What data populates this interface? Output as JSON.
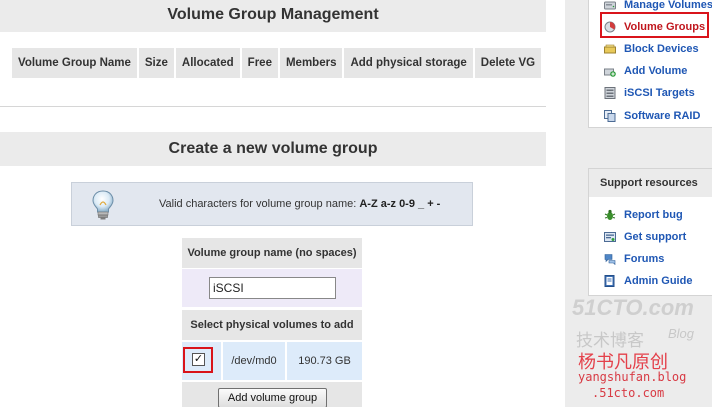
{
  "main": {
    "management_title": "Volume Group Management",
    "table_headers": [
      "Volume Group Name",
      "Size",
      "Allocated",
      "Free",
      "Members",
      "Add physical storage",
      "Delete VG"
    ],
    "create_title": "Create a new volume group",
    "info": {
      "prefix": "Valid characters for volume group name: ",
      "chars": "A-Z a-z 0-9 _ + -"
    },
    "form": {
      "name_label": "Volume group name (no spaces)",
      "name_value": "iSCSI",
      "pv_label": "Select physical volumes to add",
      "pv": {
        "checked": true,
        "check_mark": "✓",
        "device": "/dev/md0",
        "size": "190.73 GB"
      },
      "submit_label": "Add volume group"
    }
  },
  "sidebar": {
    "nav_items": [
      {
        "label": "Manage Volumes",
        "icon": "hard-disk-icon"
      },
      {
        "label": "Volume Groups",
        "icon": "volume-group-icon",
        "active": true
      },
      {
        "label": "Block Devices",
        "icon": "block-devices-icon"
      },
      {
        "label": "Add Volume",
        "icon": "add-volume-icon"
      },
      {
        "label": "iSCSI Targets",
        "icon": "iscsi-targets-icon"
      },
      {
        "label": "Software RAID",
        "icon": "software-raid-icon"
      }
    ],
    "support": {
      "title": "Support resources",
      "items": [
        {
          "label": "Report bug",
          "icon": "bug-icon"
        },
        {
          "label": "Get support",
          "icon": "support-icon"
        },
        {
          "label": "Forums",
          "icon": "forums-icon"
        },
        {
          "label": "Admin Guide",
          "icon": "admin-guide-icon"
        }
      ]
    }
  },
  "watermark": {
    "line1": "51CTO.com",
    "line2": "技术博客",
    "line2b": "Blog",
    "line3": "杨书凡原创",
    "line4": "yangshufan.blog",
    "line5": ".51cto.com"
  },
  "colors": {
    "link": "#1f57b4",
    "highlight": "#d9141b",
    "header_bg": "#ebebeb",
    "info_bg": "#e2e7ef",
    "pv_bg": "#ddebfa"
  }
}
